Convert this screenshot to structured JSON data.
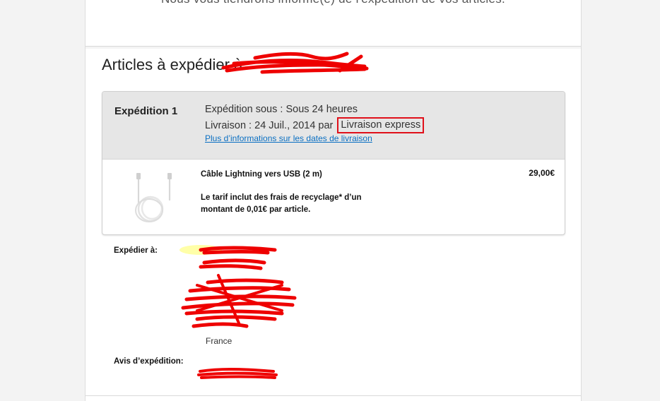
{
  "notice": "Nous vous tiendrons informé(e) de l'expédition de vos articles.",
  "section_title": "Articles à expédier à",
  "shipment": {
    "label": "Expédition 1",
    "ships_within_label": "Expédition sous : ",
    "ships_within_value": "Sous 24 heures",
    "delivery_label": "Livraison : ",
    "delivery_date": "24 Juil., 2014",
    "delivery_by": " par ",
    "delivery_method": "Livraison express",
    "more_info_link": "Plus d’informations sur les dates de livraison"
  },
  "product": {
    "name": "Câble Lightning vers USB (2 m)",
    "note": "Le tarif inclut des frais de recyclage* d’un montant de 0,01€ par article.",
    "price": "29,00€"
  },
  "ship_to": {
    "label": "Expédier à:",
    "country": "France"
  },
  "notification": {
    "label": "Avis d’expédition:"
  },
  "colors": {
    "redaction": "#ee0000",
    "highlight": "#ffff99",
    "link": "#0a6fc2",
    "express_box": "#e0101a"
  }
}
